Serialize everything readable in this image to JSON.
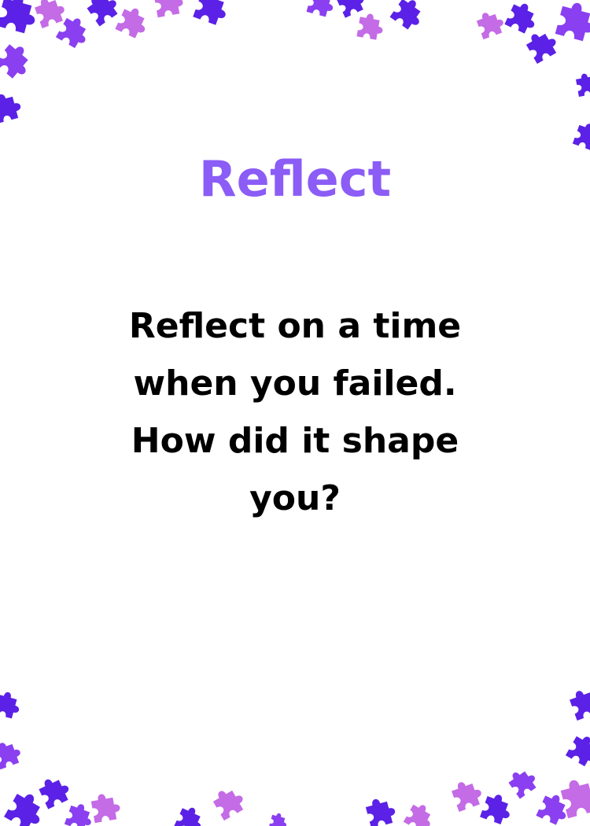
{
  "card": {
    "title": "Reflect",
    "prompt_lines": [
      "Reflect on a time",
      "when you failed.",
      "How did it shape",
      "you?"
    ]
  },
  "colors": {
    "title": "#8b5cf6",
    "text": "#000000",
    "background": "#ffffff",
    "puzzle_dark": "#5b21e6",
    "puzzle_violet": "#8a3ff0",
    "puzzle_pink": "#c46be6"
  },
  "decoration": {
    "icon": "puzzle-piece-icon"
  }
}
